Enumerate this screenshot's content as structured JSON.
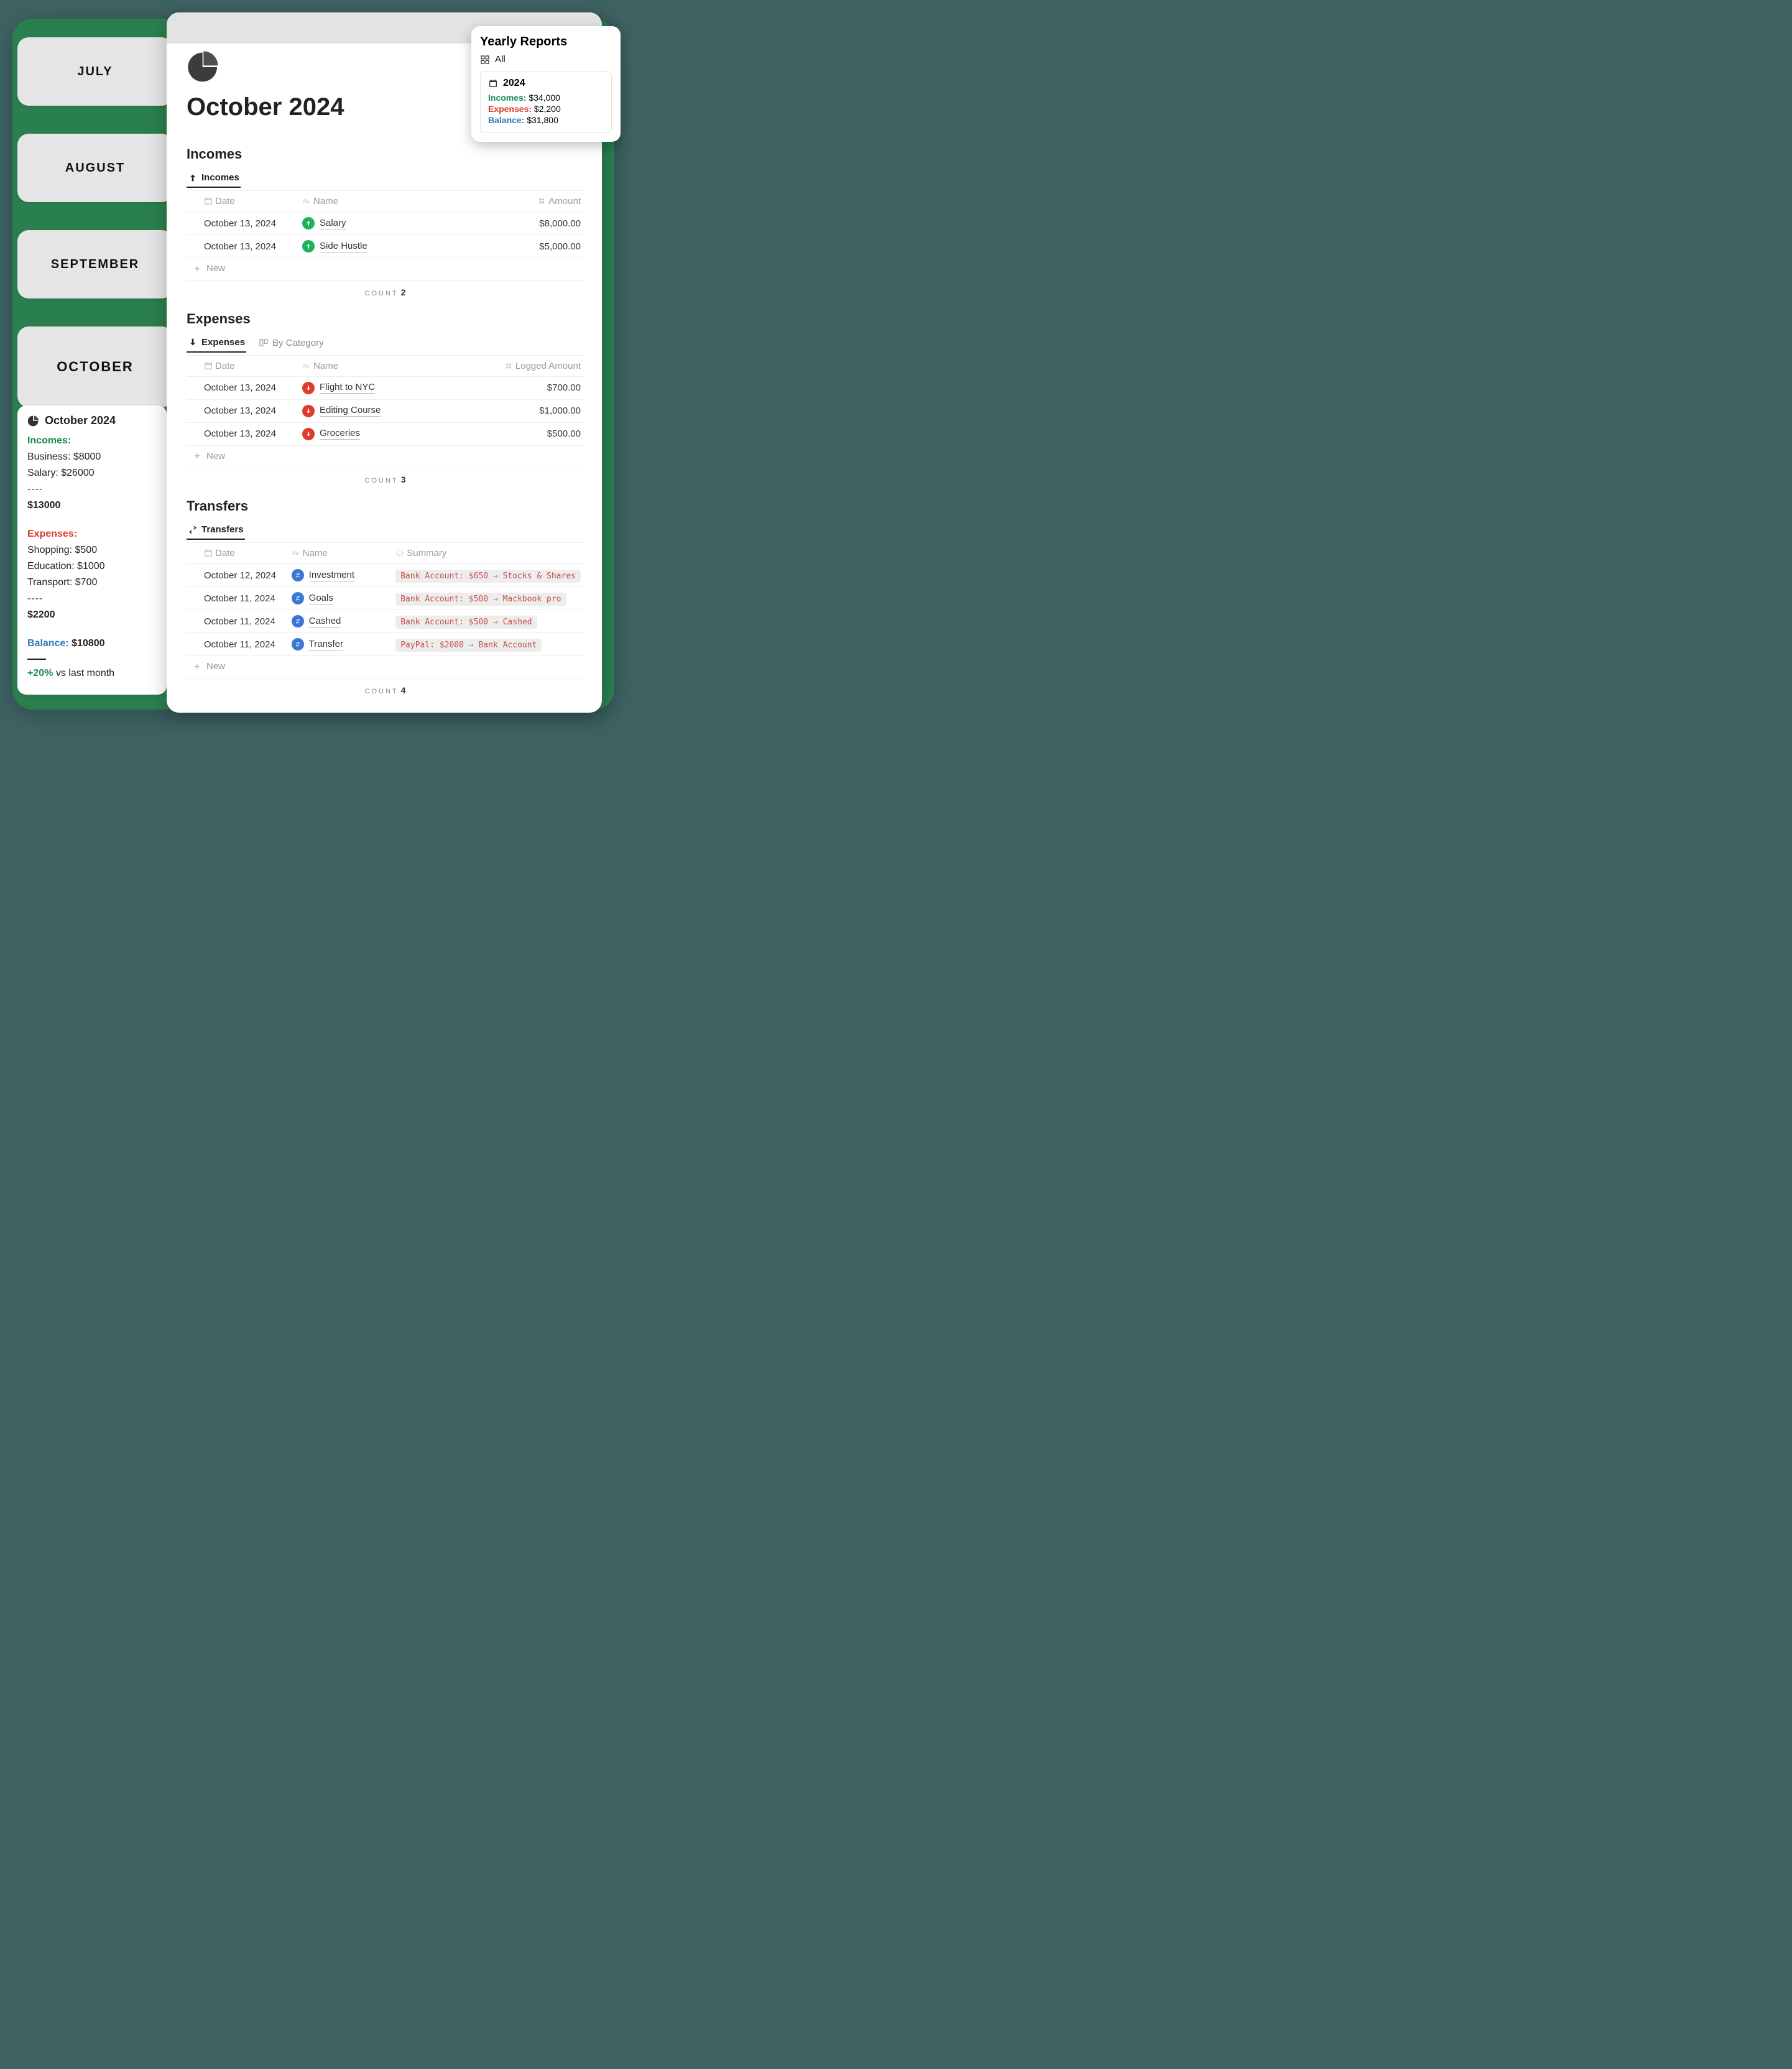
{
  "months": {
    "m1": "JULY",
    "m2": "AUGUST",
    "m3": "SEPTEMBER",
    "m4": "OCTOBER"
  },
  "summary": {
    "title": "October 2024",
    "incomes_label": "Incomes:",
    "business": "Business: $8000",
    "salary": "Salary: $26000",
    "dashes": "----",
    "income_total": "$13000",
    "expenses_label": "Expenses:",
    "shopping": "Shopping: $500",
    "education": "Education: $1000",
    "transport": "Transport: $700",
    "expense_total": "$2200",
    "balance_label": "Balance:",
    "balance_value": "$10800",
    "pct": "+20%",
    "vs": " vs last month"
  },
  "doc": {
    "title": "October 2024",
    "incomes": {
      "heading": "Incomes",
      "tab": "Incomes",
      "cols": {
        "date": "Date",
        "name": "Name",
        "amount": "Amount"
      },
      "rows": [
        {
          "date": "October 13, 2024",
          "name": "Salary",
          "amount": "$8,000.00"
        },
        {
          "date": "October 13, 2024",
          "name": "Side Hustle",
          "amount": "$5,000.00"
        }
      ],
      "new": "New",
      "count_label": "COUNT",
      "count": "2"
    },
    "expenses": {
      "heading": "Expenses",
      "tab": "Expenses",
      "tab2": "By Category",
      "cols": {
        "date": "Date",
        "name": "Name",
        "amount": "Logged Amount"
      },
      "rows": [
        {
          "date": "October 13, 2024",
          "name": "Flight to NYC",
          "amount": "$700.00"
        },
        {
          "date": "October 13, 2024",
          "name": "Editing Course",
          "amount": "$1,000.00"
        },
        {
          "date": "October 13, 2024",
          "name": "Groceries",
          "amount": "$500.00"
        }
      ],
      "new": "New",
      "count_label": "COUNT",
      "count": "3"
    },
    "transfers": {
      "heading": "Transfers",
      "tab": "Transfers",
      "cols": {
        "date": "Date",
        "name": "Name",
        "summary": "Summary"
      },
      "rows": [
        {
          "date": "October 12, 2024",
          "name": "Investment",
          "summary": "Bank Account: $650 → Stocks & Shares"
        },
        {
          "date": "October 11, 2024",
          "name": "Goals",
          "summary": "Bank Account: $500 → Mackbook pro"
        },
        {
          "date": "October 11, 2024",
          "name": "Cashed",
          "summary": "Bank Account: $500 → Cashed"
        },
        {
          "date": "October 11, 2024",
          "name": "Transfer",
          "summary": "PayPal: $2000 → Bank Account"
        }
      ],
      "new": "New",
      "count_label": "COUNT",
      "count": "4"
    }
  },
  "popover": {
    "title": "Yearly Reports",
    "all": "All",
    "year": "2024",
    "incomes_label": "Incomes:",
    "incomes_val": " $34,000",
    "expenses_label": "Expenses:",
    "expenses_val": " $2,200",
    "balance_label": "Balance:",
    "balance_val": " $31,800"
  }
}
